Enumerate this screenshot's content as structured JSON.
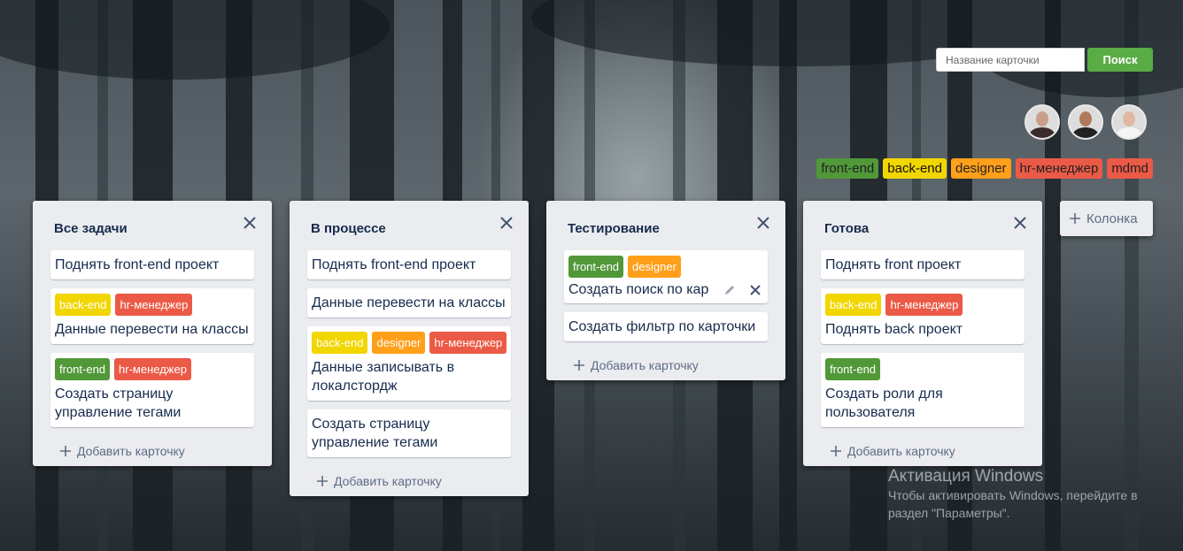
{
  "search": {
    "placeholder": "Название карточки",
    "button_label": "Поиск"
  },
  "avatars": [
    {
      "name": "avatar-1",
      "head": "#c8a08a",
      "body": "#3a2c2c"
    },
    {
      "name": "avatar-2",
      "head": "#b07a5a",
      "body": "#222222"
    },
    {
      "name": "avatar-3",
      "head": "#e0b8a0",
      "body": "#f5f5f5"
    }
  ],
  "labels": [
    {
      "text": "front-end",
      "color": "green"
    },
    {
      "text": "back-end",
      "color": "yellow"
    },
    {
      "text": "designer",
      "color": "orange"
    },
    {
      "text": "hr-менеджер",
      "color": "red"
    },
    {
      "text": "mdmd",
      "color": "red"
    }
  ],
  "add_column_label": "Колонка",
  "columns": [
    {
      "title": "Все задачи",
      "add_label": "Добавить карточку",
      "cards": [
        {
          "tags": [],
          "text": "Поднять front-end проект"
        },
        {
          "tags": [
            {
              "text": "back-end",
              "color": "yellow"
            },
            {
              "text": "hr-менеджер",
              "color": "red"
            }
          ],
          "text": "Данные перевести на классы"
        },
        {
          "tags": [
            {
              "text": "front-end",
              "color": "green"
            },
            {
              "text": "hr-менеджер",
              "color": "red"
            }
          ],
          "text": "Создать страницу управление тегами"
        }
      ]
    },
    {
      "title": "В процессе",
      "add_label": "Добавить карточку",
      "cards": [
        {
          "tags": [],
          "text": "Поднять front-end проект"
        },
        {
          "tags": [],
          "text": "Данные перевести на классы"
        },
        {
          "tags": [
            {
              "text": "back-end",
              "color": "yellow"
            },
            {
              "text": "designer",
              "color": "orange"
            },
            {
              "text": "hr-менеджер",
              "color": "red"
            }
          ],
          "text": "Данные записывать в локалстордж"
        },
        {
          "tags": [],
          "text": "Создать страницу управление тегами"
        }
      ]
    },
    {
      "title": "Тестирование",
      "add_label": "Добавить карточку",
      "cards": [
        {
          "tags": [
            {
              "text": "front-end",
              "color": "green"
            },
            {
              "text": "designer",
              "color": "orange"
            }
          ],
          "text": "Создать поиск по кар",
          "editing": true
        },
        {
          "tags": [],
          "text": "Создать фильтр по карточки"
        }
      ]
    },
    {
      "title": "Готова",
      "add_label": "Добавить карточку",
      "cards": [
        {
          "tags": [],
          "text": "Поднять front проект"
        },
        {
          "tags": [
            {
              "text": "back-end",
              "color": "yellow"
            },
            {
              "text": "hr-менеджер",
              "color": "red"
            }
          ],
          "text": "Поднять back проект"
        },
        {
          "tags": [
            {
              "text": "front-end",
              "color": "green"
            }
          ],
          "text": "Создать роли для пользователя"
        }
      ]
    }
  ],
  "activation": {
    "title": "Активация Windows",
    "subtitle": "Чтобы активировать Windows, перейдите в раздел \"Параметры\"."
  },
  "colors": {
    "green": "#519839",
    "yellow": "#f2d600",
    "orange": "#ff9f1a",
    "red": "#eb5a46",
    "accent": "#5aac44"
  }
}
